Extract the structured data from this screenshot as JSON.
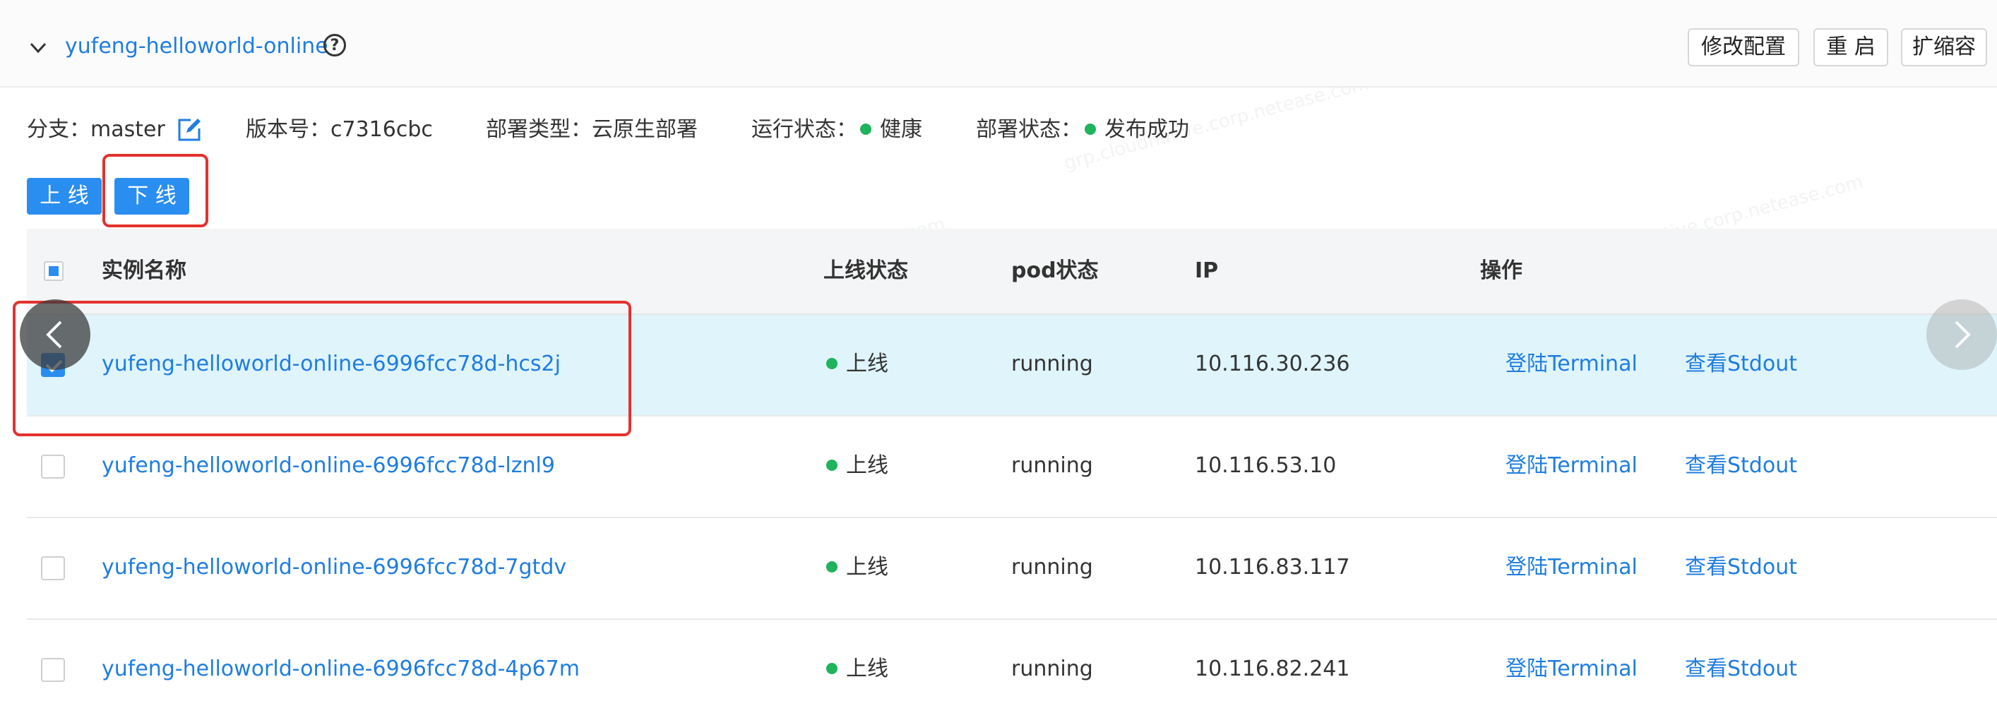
{
  "service": {
    "name": "yufeng-helloworld-online",
    "buttons": {
      "config": "修改配置",
      "restart": "重 启",
      "scale": "扩缩容"
    }
  },
  "info": {
    "branch_label": "分支：",
    "branch": "master",
    "version_label": "版本号：",
    "version": "c7316cbc",
    "deploy_type_label": "部署类型：",
    "deploy_type": "云原生部署",
    "run_status_label": "运行状态：",
    "run_status": "健康",
    "deploy_status_label": "部署状态：",
    "deploy_status": "发布成功",
    "status_color": "#1fb35b"
  },
  "actions": {
    "online": "上 线",
    "offline": "下 线"
  },
  "table": {
    "headers": {
      "name": "实例名称",
      "online_status": "上线状态",
      "pod_status": "pod状态",
      "ip": "IP",
      "ops": "操作"
    },
    "rows": [
      {
        "name": "yufeng-helloworld-online-6996fcc78d-hcs2j",
        "online": "上线",
        "pod": "running",
        "ip": "10.116.30.236",
        "op1": "登陆Terminal",
        "op2": "查看Stdout",
        "checked": true
      },
      {
        "name": "yufeng-helloworld-online-6996fcc78d-lznl9",
        "online": "上线",
        "pod": "running",
        "ip": "10.116.53.10",
        "op1": "登陆Terminal",
        "op2": "查看Stdout",
        "checked": false
      },
      {
        "name": "yufeng-helloworld-online-6996fcc78d-7gtdv",
        "online": "上线",
        "pod": "running",
        "ip": "10.116.83.117",
        "op1": "登陆Terminal",
        "op2": "查看Stdout",
        "checked": false
      },
      {
        "name": "yufeng-helloworld-online-6996fcc78d-4p67m",
        "online": "上线",
        "pod": "running",
        "ip": "10.116.82.241",
        "op1": "登陆Terminal",
        "op2": "查看Stdout",
        "checked": false
      }
    ]
  },
  "colors": {
    "accent": "#2a8df0",
    "link": "#1f7de0",
    "highlight": "#e3322e",
    "selected_row": "#dff4fb"
  }
}
